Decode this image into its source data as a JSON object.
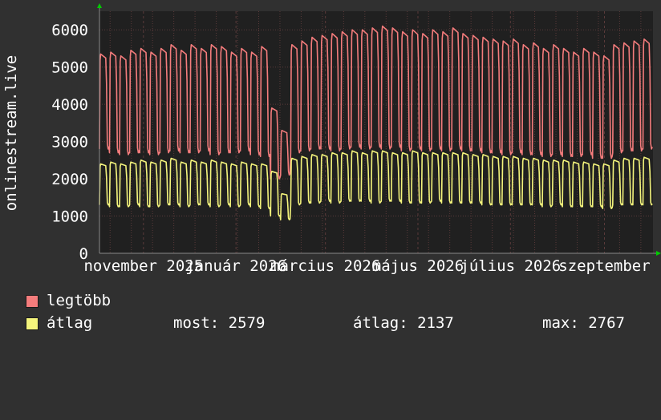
{
  "colors": {
    "background": "#303030",
    "plot_background": "#202020",
    "grid": "#5a3a3a",
    "axis": "#888888",
    "arrow": "#00cc00",
    "series_max": "#f47c7c",
    "series_avg": "#f4f47c"
  },
  "chart_data": {
    "type": "line",
    "ylabel": "onlinestream.live",
    "ylim": [
      0,
      6500
    ],
    "yticks": [
      0,
      1000,
      2000,
      3000,
      4000,
      5000,
      6000
    ],
    "xlim": [
      "2025-10-03",
      "2026-10-03"
    ],
    "xtick_labels": [
      {
        "date": "2025-11-01",
        "label": "november 2025"
      },
      {
        "date": "2026-01-01",
        "label": "január 2026"
      },
      {
        "date": "2026-03-01",
        "label": "március 2026"
      },
      {
        "date": "2026-05-01",
        "label": "május 2026"
      },
      {
        "date": "2026-07-01",
        "label": "július 2026"
      },
      {
        "date": "2026-09-01",
        "label": "szeptember"
      }
    ],
    "grid": true,
    "pattern": "weekly cycle: flat weekday plateau, dip on weekend",
    "series": [
      {
        "name": "legtöbb",
        "color": "#f47c7c",
        "weekly_peaks": [
          5350,
          5400,
          5300,
          5450,
          5500,
          5400,
          5500,
          5600,
          5450,
          5600,
          5500,
          5600,
          5550,
          5400,
          5500,
          5400,
          5550,
          3900,
          3300,
          5600,
          5700,
          5800,
          5850,
          5900,
          5950,
          6000,
          6000,
          6050,
          6100,
          6050,
          5950,
          6000,
          5900,
          6000,
          5950,
          6050,
          5900,
          5850,
          5800,
          5750,
          5700,
          5750,
          5600,
          5650,
          5500,
          5600,
          5500,
          5400,
          5500,
          5400,
          5300,
          5600,
          5650,
          5700,
          5750
        ],
        "weekly_lows": [
          2800,
          2700,
          2650,
          2700,
          2700,
          2650,
          2700,
          2750,
          2700,
          2700,
          2750,
          2650,
          2700,
          2700,
          2750,
          2650,
          2600,
          2000,
          2100,
          2700,
          2750,
          2800,
          2800,
          2750,
          2800,
          2850,
          2800,
          2850,
          2800,
          2850,
          2750,
          2800,
          2750,
          2800,
          2750,
          2800,
          2750,
          2750,
          2700,
          2700,
          2650,
          2700,
          2650,
          2650,
          2600,
          2650,
          2600,
          2600,
          2650,
          2550,
          2550,
          2700,
          2750,
          2750,
          2800
        ]
      },
      {
        "name": "átlag",
        "color": "#f4f47c",
        "weekly_peaks": [
          2400,
          2450,
          2400,
          2450,
          2500,
          2450,
          2500,
          2550,
          2450,
          2500,
          2450,
          2500,
          2450,
          2400,
          2450,
          2400,
          2400,
          2200,
          1600,
          2550,
          2600,
          2650,
          2650,
          2700,
          2700,
          2750,
          2700,
          2750,
          2750,
          2700,
          2700,
          2750,
          2700,
          2700,
          2700,
          2700,
          2700,
          2650,
          2650,
          2600,
          2600,
          2600,
          2550,
          2550,
          2500,
          2500,
          2500,
          2450,
          2450,
          2400,
          2400,
          2500,
          2550,
          2550,
          2579
        ],
        "weekly_lows": [
          1300,
          1250,
          1250,
          1300,
          1250,
          1250,
          1300,
          1300,
          1250,
          1300,
          1300,
          1250,
          1300,
          1250,
          1300,
          1250,
          1200,
          1000,
          900,
          1300,
          1350,
          1350,
          1400,
          1350,
          1400,
          1400,
          1400,
          1350,
          1400,
          1400,
          1350,
          1350,
          1350,
          1400,
          1350,
          1350,
          1350,
          1350,
          1300,
          1300,
          1300,
          1300,
          1300,
          1300,
          1250,
          1300,
          1250,
          1250,
          1250,
          1250,
          1200,
          1300,
          1300,
          1300,
          1300
        ]
      }
    ]
  },
  "legend": {
    "max_label": "legtöbb",
    "avg_label": "átlag",
    "stats": {
      "current": "most: 2579",
      "average": "átlag: 2137",
      "maximum": "max: 2767"
    }
  }
}
